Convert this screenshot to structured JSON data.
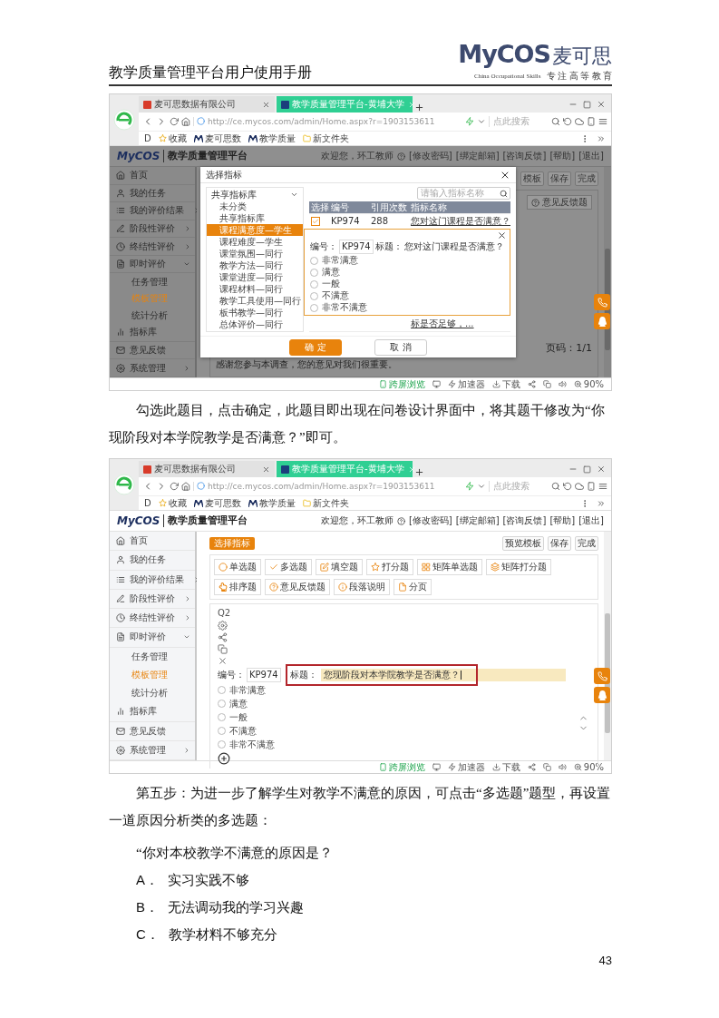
{
  "header": {
    "title": "教学质量管理平台用户使用手册",
    "logo": "MyCOS",
    "logo_cn": "麦可思",
    "tagline": "China Occupational Skills",
    "slogan": "专 注 高 等 教 育"
  },
  "screenshot_1": {
    "browser": {
      "tabs": [
        {
          "label": "麦可思数据有限公司",
          "selected": false
        },
        {
          "label": "教学质量管理平台-黄埔大学",
          "selected": true
        }
      ],
      "url": "http://ce.mycos.com/admin/Home.aspx?r=1903153611",
      "search": {
        "placeholder": "点此搜索"
      },
      "bookmark_prefix": "D",
      "bookmarks": [
        "收藏",
        "麦可思数",
        "教学质量",
        "新文件夹"
      ]
    },
    "app": {
      "logo": "MyCOS",
      "title": "教学质量管理平台",
      "welcome": "欢迎您，环工教师",
      "links": [
        "[修改密码]",
        "[绑定邮箱]",
        "[咨询反馈]",
        "[帮助]",
        "[退出]"
      ]
    },
    "sidebar": [
      {
        "label": "首页",
        "selected": false
      },
      {
        "label": "我的任务",
        "selected": false
      },
      {
        "label": "我的评价结果",
        "selected": false,
        "expanded": false
      },
      {
        "label": "阶段性评价",
        "selected": false,
        "expanded": false
      },
      {
        "label": "终结性评价",
        "selected": false,
        "expanded": false
      },
      {
        "label": "即时评价",
        "selected": false,
        "expanded": true,
        "children": [
          {
            "label": "任务管理",
            "selected": false
          },
          {
            "label": "模板管理",
            "selected": true
          },
          {
            "label": "统计分析",
            "selected": false
          }
        ]
      },
      {
        "label": "指标库",
        "selected": false
      },
      {
        "label": "意见反馈",
        "selected": false
      },
      {
        "label": "系统管理",
        "selected": false,
        "expanded": false
      }
    ],
    "toolbar_buttons": [
      "模板",
      "保存",
      "完成"
    ],
    "feedback_button": "意见反馈题",
    "pager": "页码：1/1",
    "footer_note": "感谢您参与本调查，您的意见对我们很重要。",
    "dialog": {
      "title": "选择指标",
      "tree": {
        "label": "共享指标库",
        "expanded": true,
        "children": [
          {
            "label": "未分类",
            "selected": false
          },
          {
            "label": "共享指标库",
            "selected": false
          },
          {
            "label": "课程满意度—学生",
            "selected": true
          },
          {
            "label": "课程难度—学生",
            "selected": false
          },
          {
            "label": "课堂氛围—同行",
            "selected": false
          },
          {
            "label": "教学方法—同行",
            "selected": false
          },
          {
            "label": "课堂进度—同行",
            "selected": false
          },
          {
            "label": "课程材料—同行",
            "selected": false
          },
          {
            "label": "教学工具使用—同行",
            "selected": false
          },
          {
            "label": "板书教学—同行",
            "selected": false
          },
          {
            "label": "总体评价—同行",
            "selected": false
          }
        ]
      },
      "search": {
        "placeholder": "请输入指标名称"
      },
      "columns": [
        "选择",
        "编号",
        "引用次数",
        "指标名称"
      ],
      "rows": [
        {
          "checked": true,
          "code": "KP974",
          "count": "288",
          "name": "您对这门课程是否满意？"
        },
        {
          "name": "标是否足够，..."
        }
      ],
      "preview": {
        "code_label": "编号：",
        "code": "KP974",
        "title_label": "标题：",
        "title": "您对这门课程是否满意？",
        "options": [
          {
            "label": "非常满意",
            "checked": false
          },
          {
            "label": "满意",
            "checked": false
          },
          {
            "label": "一般",
            "checked": false
          },
          {
            "label": "不满意",
            "checked": false
          },
          {
            "label": "非常不满意",
            "checked": false
          }
        ]
      },
      "buttons": [
        {
          "label": "确 定",
          "kind": "primary"
        },
        {
          "label": "取 消",
          "kind": "secondary"
        }
      ]
    },
    "status_bar": [
      "跨屏浏览",
      "加速器",
      "下载",
      "90%"
    ]
  },
  "paragraph_1": "勾选此题目，点击确定，此题目即出现在问卷设计界面中，将其题干修改为“你现阶段对本学院教学是否满意？”即可。",
  "screenshot_2": {
    "browser": {
      "tabs": [
        {
          "label": "麦可思数据有限公司",
          "selected": false
        },
        {
          "label": "教学质量管理平台-黄埔大学",
          "selected": true
        }
      ],
      "url": "http://ce.mycos.com/admin/Home.aspx?r=1903153611",
      "search": {
        "placeholder": "点此搜索"
      },
      "bookmark_prefix": "D",
      "bookmarks": [
        "收藏",
        "麦可思数",
        "教学质量",
        "新文件夹"
      ]
    },
    "app": {
      "logo": "MyCOS",
      "title": "教学质量管理平台",
      "welcome": "欢迎您，环工教师",
      "links": [
        "[修改密码]",
        "[绑定邮箱]",
        "[咨询反馈]",
        "[帮助]",
        "[退出]"
      ]
    },
    "sidebar": [
      {
        "label": "首页",
        "selected": false
      },
      {
        "label": "我的任务",
        "selected": false
      },
      {
        "label": "我的评价结果",
        "selected": false,
        "expanded": false
      },
      {
        "label": "阶段性评价",
        "selected": false,
        "expanded": false
      },
      {
        "label": "终结性评价",
        "selected": false,
        "expanded": false
      },
      {
        "label": "即时评价",
        "selected": false,
        "expanded": true,
        "children": [
          {
            "label": "任务管理",
            "selected": false
          },
          {
            "label": "模板管理",
            "selected": true
          },
          {
            "label": "统计分析",
            "selected": false
          }
        ]
      },
      {
        "label": "指标库",
        "selected": false
      },
      {
        "label": "意见反馈",
        "selected": false
      },
      {
        "label": "系统管理",
        "selected": false,
        "expanded": false
      }
    ],
    "select_button": "选择指标",
    "toolbar_buttons": [
      "预览模板",
      "保存",
      "完成"
    ],
    "question_types": [
      "单选题",
      "多选题",
      "填空题",
      "打分题",
      "矩阵单选题",
      "矩阵打分题",
      "排序题",
      "意见反馈题",
      "段落说明",
      "分页"
    ],
    "question": {
      "number": "Q2",
      "code_label": "编号：",
      "code": "KP974",
      "title_label": "标题：",
      "title": "您现阶段对本学院教学是否满意？",
      "options": [
        {
          "label": "非常满意",
          "checked": false
        },
        {
          "label": "满意",
          "checked": false
        },
        {
          "label": "一般",
          "checked": false
        },
        {
          "label": "不满意",
          "checked": false
        },
        {
          "label": "非常不满意",
          "checked": false
        }
      ]
    },
    "status_bar": [
      "跨屏浏览",
      "加速器",
      "下载",
      "90%"
    ]
  },
  "paragraph_2": "第五步：为进一步了解学生对教学不满意的原因，可点击“多选题”题型，再设置一道原因分析类的多选题：",
  "quote": "“你对本校教学不满意的原因是？",
  "options": [
    {
      "marker": "A．",
      "text": "实习实践不够"
    },
    {
      "marker": "B．",
      "text": "无法调动我的学习兴趣"
    },
    {
      "marker": "C．",
      "text": "教学材料不够充分"
    }
  ],
  "page_number": "43"
}
